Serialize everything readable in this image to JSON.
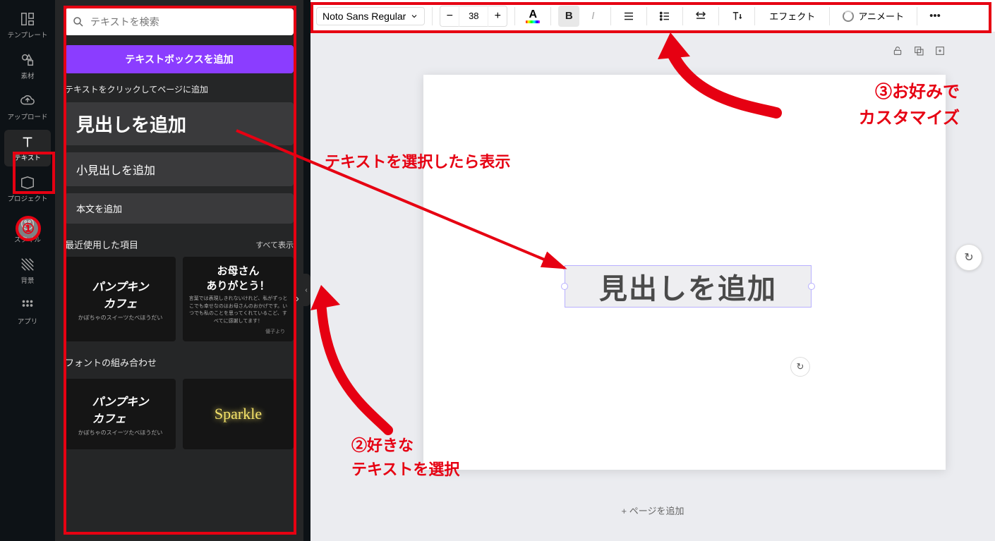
{
  "rail": {
    "template": "テンプレート",
    "elements": "素材",
    "upload": "アップロード",
    "text": "テキスト",
    "projects": "プロジェクト",
    "style": "スタイル",
    "background": "背景",
    "apps": "アプリ"
  },
  "panel": {
    "search_placeholder": "テキストを検索",
    "add_textbox": "テキストボックスを追加",
    "hint": "テキストをクリックしてページに追加",
    "h1": "見出しを追加",
    "h2": "小見出しを追加",
    "body": "本文を追加",
    "recent_title": "最近使用した項目",
    "show_all": "すべて表示",
    "thumb1_l1": "パンプキン",
    "thumb1_l2": "カフェ",
    "thumb1_sub": "かぼちゃのスイーツたべほうだい",
    "thumb2_l1": "お母さん",
    "thumb2_l2": "ありがとう！",
    "thumb2_sub": "言葉では表現しきれないけれど、私がずっとこでも幸せなのはお母さんのおかげです。いつでも私のことを思ってくれているこど、すべてに感謝してます！",
    "thumb2_sign": "優子より",
    "combo_title": "フォントの組み合わせ",
    "thumb3_l1": "パンプキン",
    "thumb3_l2": "カフェ",
    "thumb3_sub": "かぼちゃのスイーツたべほうだい",
    "sparkle": "Sparkle"
  },
  "toolbar": {
    "font": "Noto Sans Regular",
    "size": "38",
    "minus": "−",
    "plus": "+",
    "A": "A",
    "bold": "B",
    "italic": "I",
    "effect": "エフェクト",
    "animate": "アニメート"
  },
  "canvas": {
    "textbox": "見出しを追加",
    "add_page": "+ ページを追加"
  },
  "anno": {
    "a1": "テキストを選択したら表示",
    "a2_l1": "②好きな",
    "a2_l2": "テキストを選択",
    "a3_l1": "③お好みで",
    "a3_l2": "カスタマイズ",
    "n1": "①"
  }
}
